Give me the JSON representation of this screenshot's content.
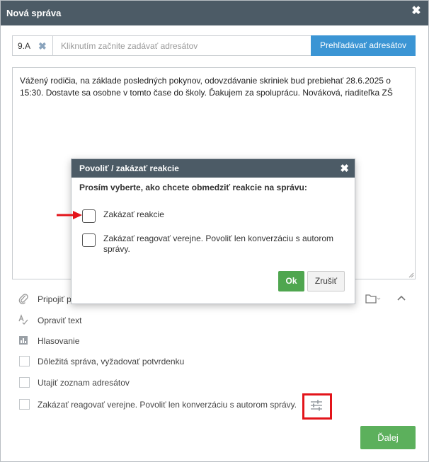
{
  "window": {
    "title": "Nová správa"
  },
  "recipients": {
    "chip_label": "9.A",
    "placeholder": "Kliknutím začnite zadávať adresátov",
    "browse_label": "Prehľadávať adresátov"
  },
  "message": {
    "body": "Vážený rodičia, na základe posledných pokynov, odovzdávanie skriniek bud prebiehať 28.6.2025 o 15:30. Dostavte sa osobne v tomto čase do školy. Ďakujem za spoluprácu. Nováková, riaditeľka ZŠ"
  },
  "options": {
    "attach_label": "Pripojiť p",
    "correct_text_label": "Opraviť text",
    "poll_label": "Hlasovanie",
    "important_label": "Dôležitá správa, vyžadovať potvrdenku",
    "hide_recipients_label": "Utajiť zoznam adresátov",
    "disable_public_label": "Zakázať reagovať verejne. Povoliť len konverzáciu s autorom správy."
  },
  "next_label": "Ďalej",
  "modal": {
    "title": "Povoliť / zakázať reakcie",
    "prompt": "Prosím vyberte, ako chcete obmedziť reakcie na správu:",
    "option1": "Zakázať reakcie",
    "option2": "Zakázať reagovať verejne. Povoliť len konverzáciu s autorom správy.",
    "ok_label": "Ok",
    "cancel_label": "Zrušiť"
  },
  "colors": {
    "titlebar": "#4c5b66",
    "browse_button": "#3b95d4",
    "next_button": "#5cb05c",
    "ok_button": "#4fa64f",
    "highlight": "#e3141a"
  },
  "icons": {
    "close": "close-icon",
    "chip_remove": "remove-icon",
    "attach": "paperclip-icon",
    "spellcheck": "spellcheck-icon",
    "poll": "bar-chart-icon",
    "folder": "folder-icon",
    "collapse": "chevron-up-icon",
    "settings": "sliders-icon",
    "arrow": "arrow-right-icon"
  }
}
